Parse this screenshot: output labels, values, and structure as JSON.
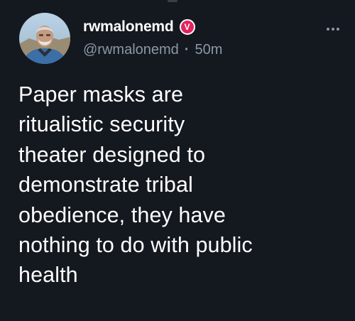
{
  "author": {
    "display_name": "rwmalonemd",
    "handle": "@rwmalonemd",
    "badge_glyph": "V",
    "badge_color": "#e0245e",
    "avatar_icon": "profile-photo"
  },
  "post": {
    "timestamp": "50m",
    "separator": "·",
    "text_lines": [
      "Paper masks are",
      "ritualistic security",
      "theater designed to",
      "demonstrate tribal",
      "obedience, they have",
      "nothing to do with public",
      "health"
    ]
  },
  "colors": {
    "background": "#14181f",
    "text_primary": "#ffffff",
    "text_secondary": "#8b98a5"
  },
  "menu": {
    "icon": "more-horizontal-icon"
  }
}
